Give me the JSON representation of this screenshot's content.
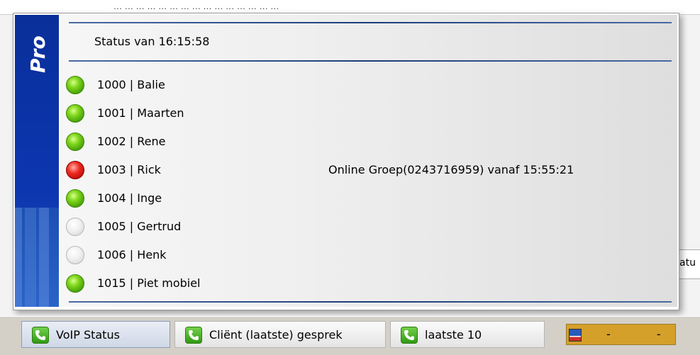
{
  "background": {
    "top_fragment": "… … … … … … … …   …   … … …   …   … …",
    "right_fragment": "atu"
  },
  "popup": {
    "brand_text": "Pro",
    "status_title": "Status van 16:15:58",
    "extensions": [
      {
        "label": "1000 | Balie",
        "state": "green",
        "note": ""
      },
      {
        "label": "1001 | Maarten",
        "state": "green",
        "note": ""
      },
      {
        "label": "1002 | Rene",
        "state": "green",
        "note": ""
      },
      {
        "label": "1003 | Rick",
        "state": "red",
        "note": "Online Groep(0243716959) vanaf 15:55:21"
      },
      {
        "label": "1004 | Inge",
        "state": "green",
        "note": ""
      },
      {
        "label": "1005 | Gertrud",
        "state": "off",
        "note": ""
      },
      {
        "label": "1006 | Henk",
        "state": "off",
        "note": ""
      },
      {
        "label": "1015 | Piet mobiel",
        "state": "green",
        "note": ""
      }
    ]
  },
  "taskbar": {
    "tabs": [
      {
        "label": "VoIP Status",
        "icon": "phone-icon",
        "active": true
      },
      {
        "label": "Cliënt (laatste) gesprek",
        "icon": "phone-icon",
        "active": false
      },
      {
        "label": "laatste 10",
        "icon": "phone-icon",
        "active": false
      }
    ],
    "language_flag": "NL",
    "language_dots": "- -"
  },
  "colors": {
    "brand_blue": "#0c36b0",
    "led_green": "#3f9a06",
    "led_red": "#d81a12",
    "led_off": "#d2d2d2",
    "flag_tab_bg": "#d4a02a"
  }
}
